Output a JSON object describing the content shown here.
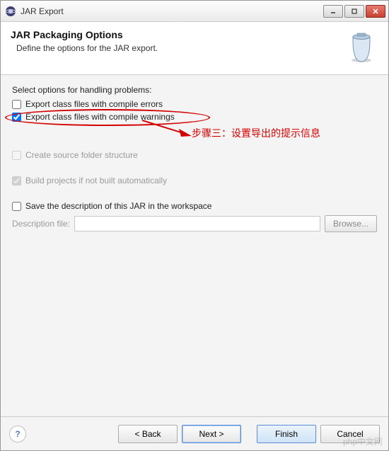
{
  "window": {
    "title": "JAR Export"
  },
  "banner": {
    "heading": "JAR Packaging Options",
    "subheading": "Define the options for the JAR export."
  },
  "section": {
    "problems_label": "Select options for handling problems:",
    "opt_errors": {
      "label": "Export class files with compile errors",
      "checked": false
    },
    "opt_warnings": {
      "label": "Export class files with compile warnings",
      "checked": true
    },
    "opt_source_folder": {
      "label": "Create source folder structure",
      "checked": false,
      "enabled": false
    },
    "opt_build": {
      "label": "Build projects if not built automatically",
      "checked": true,
      "enabled": false
    },
    "opt_save_desc": {
      "label": "Save the description of this JAR in the workspace",
      "checked": false
    },
    "desc_file": {
      "label": "Description file:",
      "value": "",
      "browse": "Browse..."
    }
  },
  "annotation": {
    "text": "步骤三：设置导出的提示信息"
  },
  "footer": {
    "help": "?",
    "back": "< Back",
    "next": "Next >",
    "finish": "Finish",
    "cancel": "Cancel"
  },
  "watermark": "php中文网"
}
